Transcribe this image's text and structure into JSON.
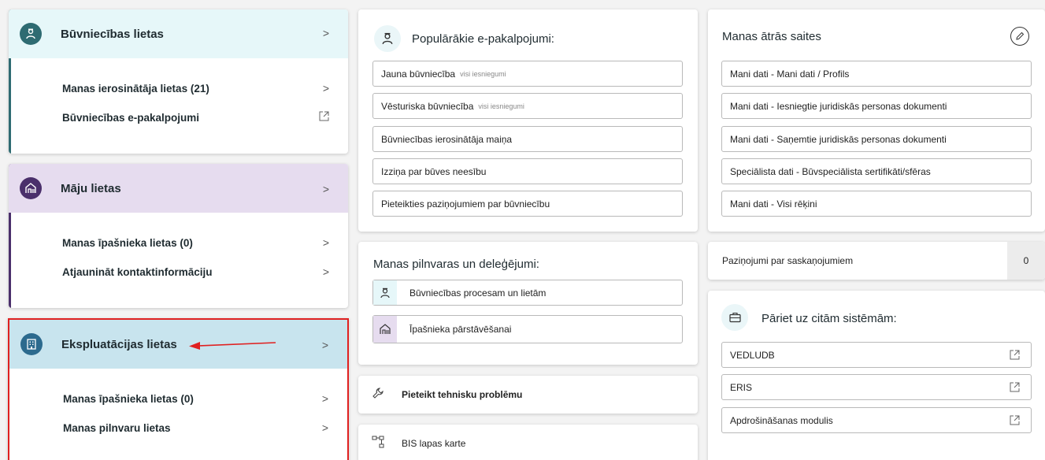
{
  "left": {
    "buvniecibas": {
      "title": "Būvniecības lietas",
      "items": [
        {
          "label": "Manas ierosinātāja lietas (21)"
        },
        {
          "label": "Būvniecības e-pakalpojumi"
        }
      ]
    },
    "maju": {
      "title": "Māju lietas",
      "items": [
        {
          "label": "Manas īpašnieka lietas (0)"
        },
        {
          "label": "Atjaunināt kontaktinformāciju"
        }
      ]
    },
    "ekspluatacijas": {
      "title": "Ekspluatācijas lietas",
      "items": [
        {
          "label": "Manas īpašnieka lietas (0)"
        },
        {
          "label": "Manas pilnvaru lietas"
        }
      ]
    }
  },
  "popular": {
    "title": "Populārākie e-pakalpojumi:",
    "items": [
      {
        "label": "Jauna būvniecība",
        "sub": "visi iesniegumi"
      },
      {
        "label": "Vēsturiska būvniecība",
        "sub": "visi iesniegumi"
      },
      {
        "label": "Būvniecības ierosinātāja maiņa"
      },
      {
        "label": "Izziņa par būves neesību"
      },
      {
        "label": "Pieteikties paziņojumiem par būvniecību"
      }
    ]
  },
  "mandates": {
    "title": "Manas pilnvaras un deleģējumi:",
    "items": [
      {
        "label": "Būvniecības procesam un lietām"
      },
      {
        "label": "Īpašnieka pārstāvēšanai"
      }
    ]
  },
  "report": {
    "label": "Pieteikt tehnisku problēmu"
  },
  "sitemap": {
    "label": "BIS lapas karte"
  },
  "quicklinks": {
    "title": "Manas ātrās saites",
    "items": [
      {
        "label": "Mani dati - Mani dati / Profils"
      },
      {
        "label": "Mani dati - Iesniegtie juridiskās personas dokumenti"
      },
      {
        "label": "Mani dati - Saņemtie juridiskās personas dokumenti"
      },
      {
        "label": "Speciālista dati - Būvspeciālista sertifikāti/sfēras"
      },
      {
        "label": "Mani dati - Visi rēķini"
      }
    ]
  },
  "notifications": {
    "label": "Paziņojumi par saskaņojumiem",
    "count": "0"
  },
  "systems": {
    "title": "Pāriet uz citām sistēmām:",
    "items": [
      {
        "label": "VEDLUDB"
      },
      {
        "label": "ERIS"
      },
      {
        "label": "Apdrošināšanas modulis"
      }
    ]
  },
  "colors": {
    "teal": "#2e6b72",
    "purple": "#4a2f6b",
    "blue": "#2c6a8e",
    "teal_bg": "#e6f7f9",
    "purple_bg": "#e6dcef",
    "blue_bg": "#c8e4ee",
    "highlight": "#e02020"
  }
}
